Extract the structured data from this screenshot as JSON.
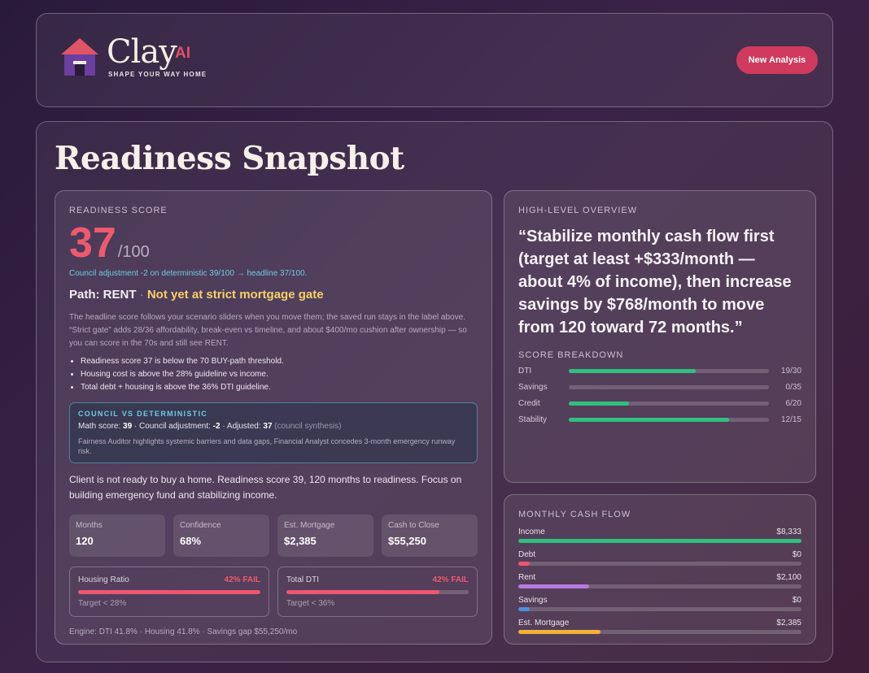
{
  "brand": {
    "name": "Clay",
    "ai": "AI",
    "tagline": "Shape Your way Home",
    "accent": "#d03a5e"
  },
  "header": {
    "new_analysis_label": "New Analysis"
  },
  "page_title": "Readiness Snapshot",
  "readiness": {
    "eyebrow": "Readiness Score",
    "score": "37",
    "max": "/100",
    "council_line": "Council adjustment -2 on deterministic 39/100 → headline 37/100.",
    "path_label": "Path: RENT",
    "path_sep": "·",
    "path_status": "Not yet at strict mortgage gate",
    "description": "The headline score follows your scenario sliders when you move them; the saved run stays in the label above. “Strict gate” adds 28/36 affordability, break-even vs timeline, and about $400/mo cushion after ownership — so you can score in the 70s and still see RENT.",
    "bullets": [
      "Readiness score 37 is below the 70 BUY-path threshold.",
      "Housing cost is above the 28% guideline vs income.",
      "Total debt + housing is above the 36% DTI guideline."
    ],
    "council": {
      "title": "Council vs Deterministic",
      "math_label": "Math score:",
      "math_value": "39",
      "adj_label": "Council adjustment:",
      "adj_value": "-2",
      "adjusted_label": "Adjusted:",
      "adjusted_value": "37",
      "note": "(council synthesis)",
      "description": "Fairness Auditor highlights systemic barriers and data gaps, Financial Analyst concedes 3-month emergency runway risk."
    },
    "summary": "Client is not ready to buy a home. Readiness score 39, 120 months to readiness. Focus on building emergency fund and stabilizing income.",
    "stats": [
      {
        "label": "Months",
        "value": "120"
      },
      {
        "label": "Confidence",
        "value": "68%"
      },
      {
        "label": "Est. Mortgage",
        "value": "$2,385"
      },
      {
        "label": "Cash to Close",
        "value": "$55,250"
      }
    ],
    "ratios": [
      {
        "label": "Housing Ratio",
        "status": "42% FAIL",
        "fill_pct": 100,
        "target": "Target < 28%"
      },
      {
        "label": "Total DTI",
        "status": "42% FAIL",
        "fill_pct": 84,
        "target": "Target < 36%"
      }
    ],
    "engine": "Engine: DTI 41.8% · Housing 41.8% · Savings gap $55,250/mo"
  },
  "overview": {
    "eyebrow": "High-Level Overview",
    "quote": "“Stabilize monthly cash flow first (target at least +$333/month — about 4% of income), then increase savings by $768/month to move from 120 toward 72 months.”",
    "breakdown_eyebrow": "Score Breakdown",
    "breakdown": [
      {
        "label": "DTI",
        "value": "19/30",
        "score": 19,
        "max": 30
      },
      {
        "label": "Savings",
        "value": "0/35",
        "score": 0,
        "max": 35
      },
      {
        "label": "Credit",
        "value": "6/20",
        "score": 6,
        "max": 20
      },
      {
        "label": "Stability",
        "value": "12/15",
        "score": 12,
        "max": 15
      }
    ]
  },
  "cash_flow": {
    "eyebrow": "Monthly Cash Flow",
    "items": [
      {
        "label": "Income",
        "value": "$8,333",
        "fill_pct": 100,
        "color": "#2fc07e"
      },
      {
        "label": "Debt",
        "value": "$0",
        "fill_pct": 4,
        "color": "#ef5670"
      },
      {
        "label": "Rent",
        "value": "$2,100",
        "fill_pct": 25,
        "color": "#b47ae0"
      },
      {
        "label": "Savings",
        "value": "$0",
        "fill_pct": 4,
        "color": "#4a8fe0"
      },
      {
        "label": "Est. Mortgage",
        "value": "$2,385",
        "fill_pct": 29,
        "color": "#f4b23a"
      }
    ]
  }
}
